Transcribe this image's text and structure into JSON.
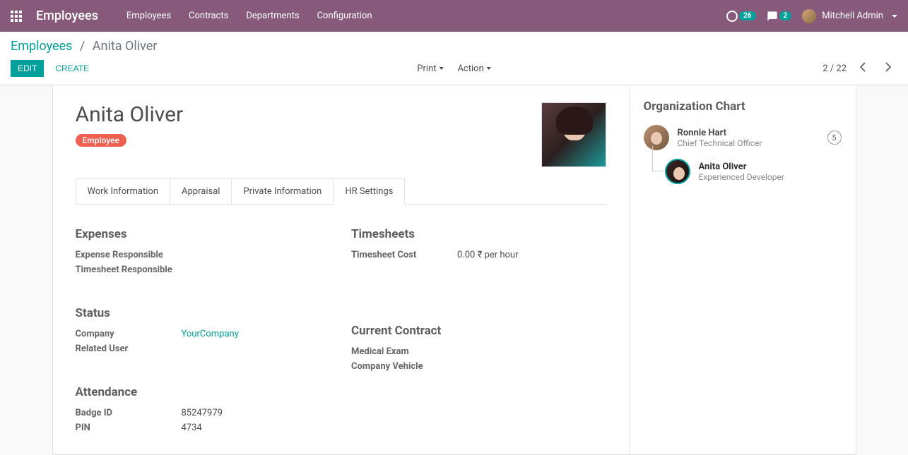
{
  "header": {
    "brand": "Employees",
    "menu": [
      "Employees",
      "Contracts",
      "Departments",
      "Configuration"
    ],
    "activities_count": "26",
    "messages_count": "2",
    "user_name": "Mitchell Admin"
  },
  "breadcrumb": {
    "root": "Employees",
    "current": "Anita Oliver"
  },
  "controls": {
    "edit": "EDIT",
    "create": "CREATE",
    "print": "Print",
    "action": "Action",
    "pager": "2 / 22"
  },
  "employee": {
    "name": "Anita Oliver",
    "tag": "Employee"
  },
  "tabs": [
    "Work Information",
    "Appraisal",
    "Private Information",
    "HR Settings"
  ],
  "active_tab_index": 3,
  "hr_settings": {
    "expenses": {
      "title": "Expenses",
      "expense_responsible_label": "Expense Responsible",
      "expense_responsible_value": "",
      "timesheet_responsible_label": "Timesheet Responsible",
      "timesheet_responsible_value": ""
    },
    "timesheets": {
      "title": "Timesheets",
      "cost_label": "Timesheet Cost",
      "cost_value": "0.00 ₹ per hour"
    },
    "status": {
      "title": "Status",
      "company_label": "Company",
      "company_value": "YourCompany",
      "related_user_label": "Related User",
      "related_user_value": ""
    },
    "current_contract": {
      "title": "Current Contract",
      "medical_exam_label": "Medical Exam",
      "medical_exam_value": "",
      "company_vehicle_label": "Company Vehicle",
      "company_vehicle_value": ""
    },
    "attendance": {
      "title": "Attendance",
      "badge_id_label": "Badge ID",
      "badge_id_value": "85247979",
      "pin_label": "PIN",
      "pin_value": "4734"
    }
  },
  "org_chart": {
    "title": "Organization Chart",
    "manager": {
      "name": "Ronnie Hart",
      "role": "Chief Technical Officer",
      "count": "5"
    },
    "current": {
      "name": "Anita Oliver",
      "role": "Experienced Developer"
    }
  }
}
